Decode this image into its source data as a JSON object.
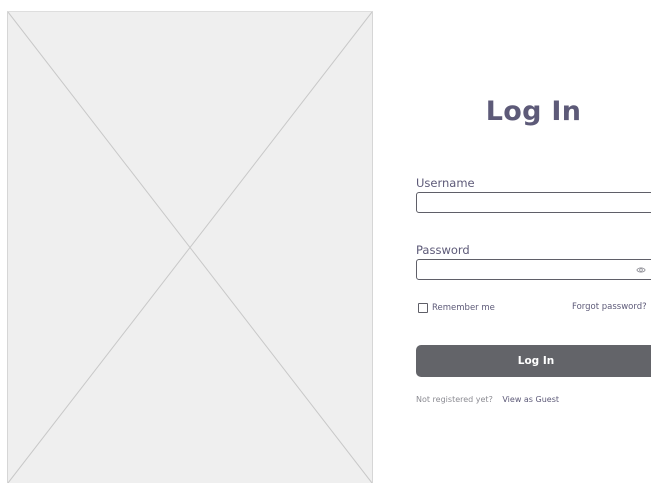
{
  "login": {
    "title": "Log In",
    "username_label": "Username",
    "username_value": "",
    "password_label": "Password",
    "password_value": "",
    "remember_label": "Remember me",
    "remember_checked": false,
    "forgot_label": "Forgot password?",
    "submit_label": "Log In",
    "not_registered": "Not registered yet?",
    "guest_label": "View as Guest"
  },
  "icons": {
    "password_toggle": "eye-icon",
    "image_placeholder": "image-placeholder"
  },
  "colors": {
    "accent_text": "#5d5a78",
    "button_background": "#636469",
    "button_text": "#ffffff",
    "placeholder_fill": "#efefef",
    "placeholder_lines": "#c8c8c8",
    "muted_text": "#8c8c93"
  }
}
